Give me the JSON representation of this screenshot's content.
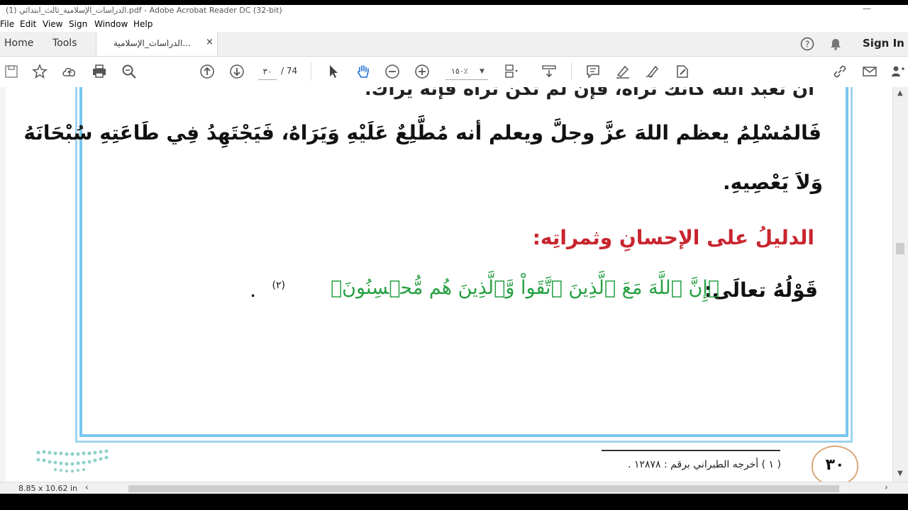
{
  "window": {
    "title": "الدراسات_الإسلامية_ثالث_ابتدائي (1).pdf - Adobe Acrobat Reader DC (32-bit)"
  },
  "menu": [
    "File",
    "Edit",
    "View",
    "Sign",
    "Window",
    "Help"
  ],
  "tabs": {
    "home": "Home",
    "tools": "Tools",
    "document": "الدراسات_الإسلامية...",
    "close": "×",
    "sign_in": "Sign In"
  },
  "toolbar": {
    "page_current": "٣٠",
    "page_total": "/ 74",
    "zoom": "١٥٠٪"
  },
  "content": {
    "line_top": "أن تعبد الله كأنك تراه، فإن لم تكن تراه فإنه يراك.",
    "line1": "فَالمُسْلِمُ يعظم اللهَ عزَّ وجلَّ ويعلم أنه مُطَّلِعٌ عَلَيْهِ وَيَرَاهُ، فَيَجْتَهِدُ فِي طَاعَتِهِ سُبْحَانَهُ",
    "line2": "وَلاَ يَعْصِيهِ.",
    "heading": "الدليلُ على الإحسانِ وثمراتِه:",
    "verse_intro": "قَوْلُهُ تعالَى:",
    "verse": "﴿إِنَّ ٱللَّهَ مَعَ ٱلَّذِينَ ٱتَّقَواْ وَّٱلَّذِينَ هُم مُّحۡسِنُونَ﴾",
    "verse_ref": "(٢)",
    "verse_end": ".",
    "footnote": "( ١ ) أخرجه الطبراني برقم : ١٢٨٧٨ .",
    "page_number": "٣٠"
  },
  "status": {
    "page_size": "8.85 x 10.62 in"
  },
  "colors": {
    "frame_outer": "#9fd3f0",
    "frame_inner": "#78c7ee",
    "heading": "#c8252e",
    "verse": "#27a043"
  }
}
